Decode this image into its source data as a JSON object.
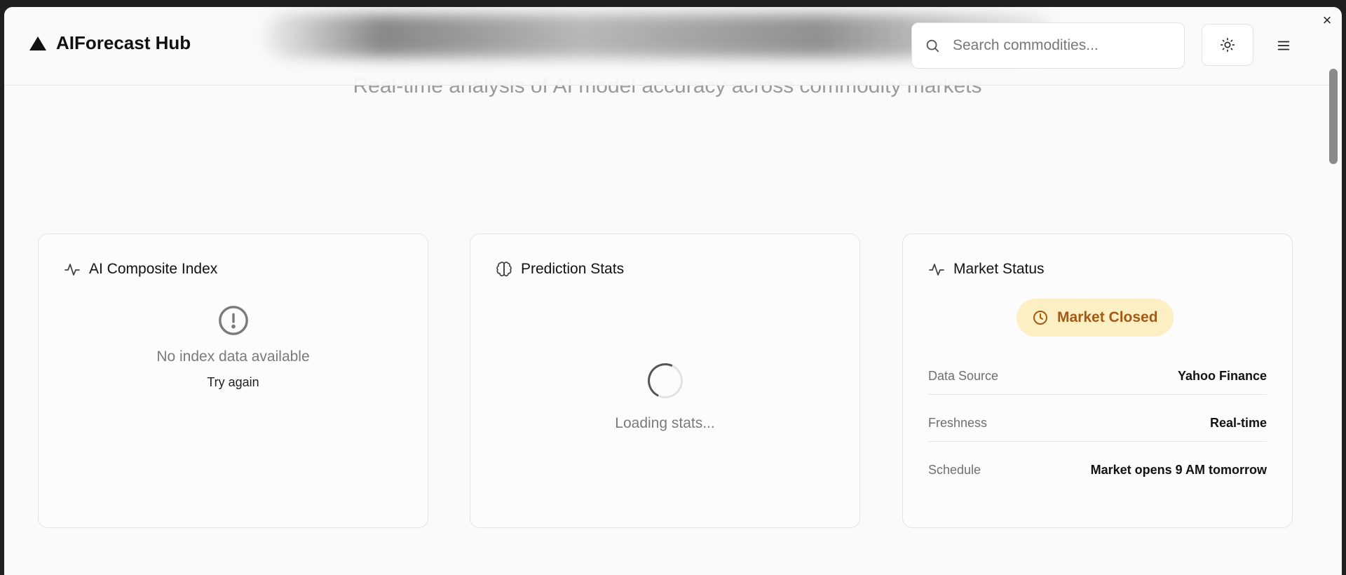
{
  "app": {
    "title": "AIForecast Hub",
    "subtitle": "Real-time analysis of AI model accuracy across commodity markets"
  },
  "search": {
    "placeholder": "Search commodities...",
    "value": ""
  },
  "header": {
    "theme_icon": "sun-icon",
    "menu_icon": "hamburger-menu-icon",
    "logo_icon": "triangle-logo-icon"
  },
  "cards": {
    "composite": {
      "title": "AI Composite Index",
      "icon": "activity-icon",
      "empty_icon": "alert-circle-icon",
      "empty_text": "No index data available",
      "retry_label": "Try again"
    },
    "prediction": {
      "title": "Prediction Stats",
      "icon": "brain-icon",
      "loading_text": "Loading stats..."
    },
    "market": {
      "title": "Market Status",
      "icon": "activity-icon",
      "status_label": "Market Closed",
      "status_icon": "clock-icon",
      "rows": [
        {
          "key": "Data Source",
          "value": "Yahoo Finance"
        },
        {
          "key": "Freshness",
          "value": "Real-time"
        },
        {
          "key": "Schedule",
          "value": "Market opens 9 AM tomorrow"
        }
      ]
    }
  },
  "colors": {
    "status_pill_bg": "#fcefc4",
    "status_pill_text": "#a45a12",
    "page_bg": "#fafafa"
  }
}
